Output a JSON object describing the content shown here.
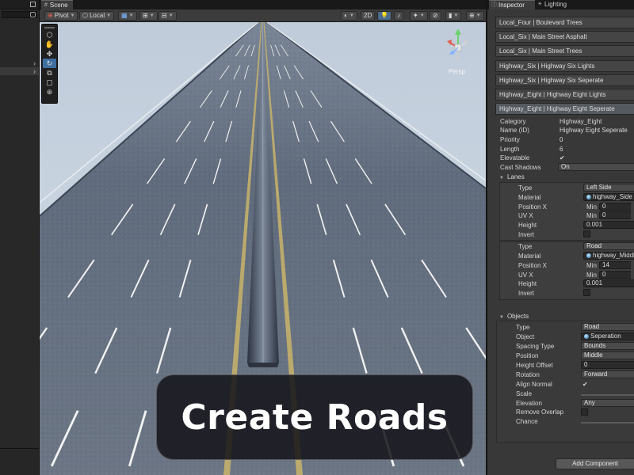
{
  "scene_tab": {
    "label": "Scene"
  },
  "toolbar": {
    "pivot": "Pivot",
    "local": "Local",
    "twod": "2D"
  },
  "viewport": {
    "perspective_label": "Persp",
    "title_banner": "Create Roads"
  },
  "inspector": {
    "tabs": {
      "inspector": "Inspector",
      "lighting": "Lighting"
    },
    "road_list": [
      "Local_Four | Boulevard Trees",
      "Local_Six | Main Street Asphalt",
      "Local_Six | Main Street Trees",
      "Highway_Six | Highway Six Lights",
      "Highway_Six | Highway Six Seperate",
      "Highway_Eight | Highway Eight Lights",
      "Highway_Eight | Highway Eight Seperate"
    ],
    "properties": {
      "category": {
        "label": "Category",
        "value": "Highway_Eight"
      },
      "name": {
        "label": "Name (ID)",
        "value": "Highway Eight Seperate"
      },
      "priority": {
        "label": "Priority",
        "value": "0"
      },
      "length": {
        "label": "Length",
        "value": "6"
      },
      "elevatable": {
        "label": "Elevatable",
        "checked": "✔"
      },
      "cast_shadows": {
        "label": "Cast Shadows",
        "value": "On"
      }
    },
    "lanes": {
      "header": "Lanes",
      "items": [
        {
          "type_label": "Type",
          "type": "Left Side",
          "material_label": "Material",
          "material": "highway_Side",
          "position_x_label": "Position X",
          "position_min_label": "Min",
          "position_min": "0",
          "uv_x_label": "UV X",
          "uv_min_label": "Min",
          "uv_min": "0",
          "height_label": "Height",
          "height": "0.001",
          "invert_label": "Invert"
        },
        {
          "type_label": "Type",
          "type": "Road",
          "material_label": "Material",
          "material": "highway_Middle",
          "position_x_label": "Position X",
          "position_min_label": "Min",
          "position_min": "14",
          "uv_x_label": "UV X",
          "uv_min_label": "Min",
          "uv_min": "0",
          "height_label": "Height",
          "height": "0.001",
          "invert_label": "Invert"
        }
      ]
    },
    "objects": {
      "header": "Objects",
      "type_label": "Type",
      "type": "Road",
      "object_label": "Object",
      "object": "Seperation",
      "spacing_type_label": "Spacing Type",
      "spacing_type": "Bounds",
      "position_label": "Position",
      "position": "Middle",
      "height_offset_label": "Height Offset",
      "height_offset": "0",
      "rotation_label": "Rotation",
      "rotation": "Forward",
      "align_normal_label": "Align Normal",
      "align_normal_checked": "✔",
      "scale_label": "Scale",
      "elevation_label": "Elevation",
      "elevation": "Any",
      "remove_overlap_label": "Remove Overlap",
      "chance_label": "Chance"
    },
    "add_component": "Add Component"
  },
  "colors": {
    "sky": "#cbd6e3",
    "asphalt": "#5c6878",
    "lane_marking": "#f2f2f2",
    "yellow_line": "#c9b46a",
    "accent_blue": "#3e6f9e"
  }
}
